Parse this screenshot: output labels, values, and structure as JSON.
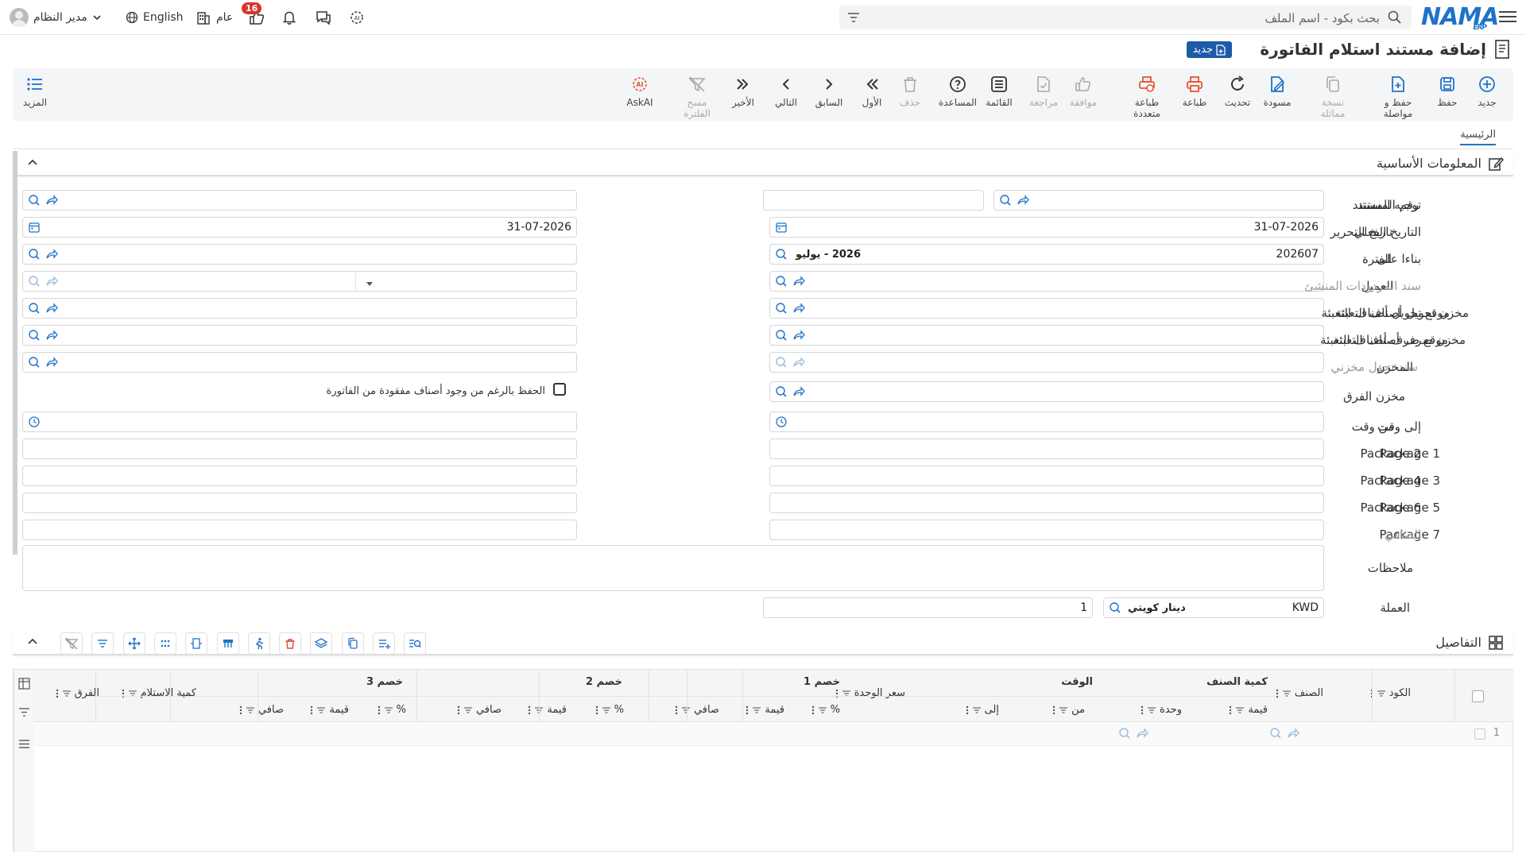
{
  "topbar": {
    "logo": "NAMA",
    "logo_sub": "ERP",
    "search_placeholder": "بحث بكود - اسم الملف",
    "notifications_count": "16",
    "branch": "عام",
    "language": "English",
    "user": "مدير النظام"
  },
  "page": {
    "title": "إضافة مستند استلام الفاتورة",
    "new_badge": "جديد"
  },
  "toolbar": {
    "buttons": [
      {
        "label": "جديد",
        "icon": "plus-circle-icon",
        "color": "#1f73c9"
      },
      {
        "label": "حفظ",
        "icon": "save-icon",
        "color": "#1f73c9"
      },
      {
        "label": "حفظ و مواصلة",
        "icon": "save-continue-icon",
        "color": "#1f73c9"
      },
      {
        "label": "نسخة مماثلة",
        "icon": "copy-icon",
        "color": "#aaa"
      },
      {
        "label": "مسودة",
        "icon": "draft-icon",
        "color": "#1f73c9"
      },
      {
        "label": "تحديث",
        "icon": "refresh-icon",
        "color": "#333"
      },
      {
        "label": "طباعة",
        "icon": "print-icon",
        "color": "#e8542d"
      },
      {
        "label": "طباعة متعددة",
        "icon": "multi-print-icon",
        "color": "#e8542d"
      },
      {
        "label": "موافقة",
        "icon": "approve-icon",
        "color": "#aaa"
      },
      {
        "label": "مراجعة",
        "icon": "review-icon",
        "color": "#aaa"
      },
      {
        "label": "القائمة",
        "icon": "list-icon",
        "color": "#333"
      },
      {
        "label": "المساعدة",
        "icon": "help-icon",
        "color": "#333"
      },
      {
        "label": "حذف",
        "icon": "delete-icon",
        "color": "#aaa"
      },
      {
        "label": "الأول",
        "icon": "first-icon",
        "color": "#333"
      },
      {
        "label": "السابق",
        "icon": "previous-icon",
        "color": "#333"
      },
      {
        "label": "التالي",
        "icon": "next-icon",
        "color": "#333"
      },
      {
        "label": "الأخير",
        "icon": "last-icon",
        "color": "#333"
      },
      {
        "label": "مسح الفلترة",
        "icon": "clear-filter-icon",
        "color": "#aaa"
      },
      {
        "label": "AskAI",
        "icon": "ai-icon",
        "color": "#e8542d"
      }
    ],
    "more": "المزيد"
  },
  "tabs": {
    "main": "الرئيسية"
  },
  "basic_info": {
    "title": "المعلومات الأساسية",
    "doc_number": {
      "label": "رقم المستند",
      "value": ""
    },
    "doc_direction": {
      "label": "توجيه المستند",
      "value": ""
    },
    "edit_date": {
      "label": "تاريخ التحرير",
      "value": "31-07-2026"
    },
    "actual_date": {
      "label": "التاريخ الفعلي",
      "value": "31-07-2026"
    },
    "period": {
      "label": "الفترة",
      "code": "202607",
      "name": "2026 - يوليو"
    },
    "based_on": {
      "label": "بناءا على",
      "value": ""
    },
    "customer": {
      "label": "العميل",
      "value": ""
    },
    "returns_doc": {
      "label": "سند المردودات المنشئ",
      "value": ""
    },
    "pack_transfer_store": {
      "label": "مخزن تحويل أصناف التعبئة",
      "value": ""
    },
    "pack_transfer_location": {
      "label": "موقع تحويل أصناف التعبئة",
      "value": ""
    },
    "pack_issue_store": {
      "label": "مخزن صرف أصناف التعبئة",
      "value": ""
    },
    "pack_issue_location": {
      "label": "موقع صرف أصناف التعبئة",
      "value": ""
    },
    "store_transfer_doc": {
      "label": "سند تحول مخزني",
      "value": ""
    },
    "store": {
      "label": "المخزن",
      "value": ""
    },
    "diff_store": {
      "label": "مخزن الفرق",
      "value": ""
    },
    "save_missing": {
      "label": "الحفظ بالرغم من وجود أصناف مفقودة من الفاتورة"
    },
    "from_time": {
      "label": "من وقت",
      "value": ""
    },
    "to_time": {
      "label": "إلى وقت",
      "value": ""
    },
    "package1": {
      "label": "Package 1",
      "value": ""
    },
    "package2": {
      "label": "Package 2",
      "value": ""
    },
    "package3": {
      "label": "Package 3",
      "value": ""
    },
    "package4": {
      "label": "Package 4",
      "value": ""
    },
    "package5": {
      "label": "Package 5",
      "value": ""
    },
    "package6": {
      "label": "Package 6",
      "value": ""
    },
    "package7": {
      "label": "Package 7",
      "value": ""
    },
    "net": {
      "label": "الصافي",
      "value": ""
    },
    "notes": {
      "label": "ملاحظات",
      "value": ""
    },
    "currency": {
      "label": "العملة",
      "code": "KWD",
      "name": "دينار كويتي",
      "rate": "1"
    }
  },
  "details": {
    "title": "التفاصيل",
    "groups": {
      "item_qty": "كمية الصنف",
      "time": "الوقت",
      "disc1": "خصم 1",
      "disc2": "خصم 2",
      "disc3": "خصم 3"
    },
    "columns": {
      "code": "الكود",
      "item": "الصنف",
      "value": "قيمة",
      "unit": "وحدة",
      "from": "من",
      "to": "إلى",
      "unit_price": "سعر الوحدة",
      "percent": "%",
      "net": "صافي",
      "received_qty": "كمية الاستلام",
      "difference": "الفرق"
    },
    "rows": [
      {
        "num": "1"
      }
    ]
  }
}
